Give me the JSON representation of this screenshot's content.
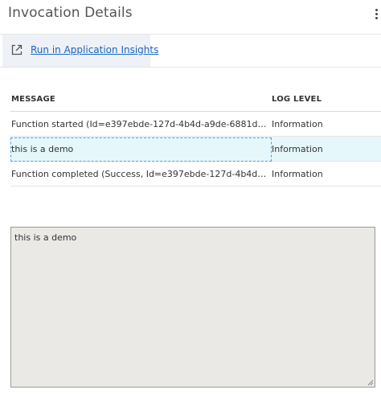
{
  "header": {
    "title": "Invocation Details",
    "more_icon": "more-vertical-icon"
  },
  "toolbar": {
    "run_label": "Run in Application Insights",
    "run_icon": "external-link-icon"
  },
  "table": {
    "columns": {
      "message": "MESSAGE",
      "log_level": "LOG LEVEL"
    },
    "rows": [
      {
        "message": "Function started (Id=e397ebde-127d-4b4d-a9de-6881d9e...",
        "log_level": "Information",
        "selected": false
      },
      {
        "message": "this is a demo",
        "log_level": "Information",
        "selected": true
      },
      {
        "message": "Function completed (Success, Id=e397ebde-127d-4b4d-a9...",
        "log_level": "Information",
        "selected": false
      }
    ]
  },
  "detail": {
    "text": "this is a demo"
  },
  "colors": {
    "link": "#1a66c2",
    "selected_row": "#e6f7fc",
    "detail_background": "#ebe9e5"
  }
}
